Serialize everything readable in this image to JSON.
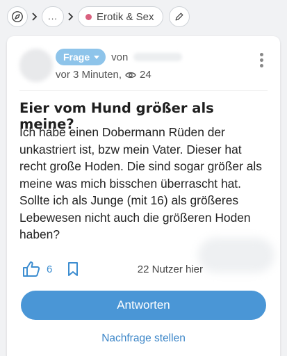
{
  "breadcrumb": {
    "more_label": "...",
    "topic_label": "Erotik & Sex",
    "topic_color": "#d9617f"
  },
  "question": {
    "type_badge": "Frage",
    "author_prefix": "von",
    "time_ago": "vor 3 Minuten,",
    "views": "24",
    "title": "Eier vom Hund größer als meine?",
    "body": "Ich habe einen Dobermann Rüden der unkastriert ist, bzw mein Vater. Dieser hat recht große Hoden. Die sind sogar größer als meine was mich bisschen überrascht hat. Sollte ich als Junge (mit 16) als größeres Lebewesen nicht auch die größeren Hoden haben?"
  },
  "actions": {
    "like_count": "6",
    "users_here": "22 Nutzer hier",
    "answer_button": "Antworten",
    "followup_link": "Nachfrage stellen"
  },
  "colors": {
    "accent": "#4a96d6",
    "badge": "#8ec4ea",
    "link": "#3c86c8"
  }
}
